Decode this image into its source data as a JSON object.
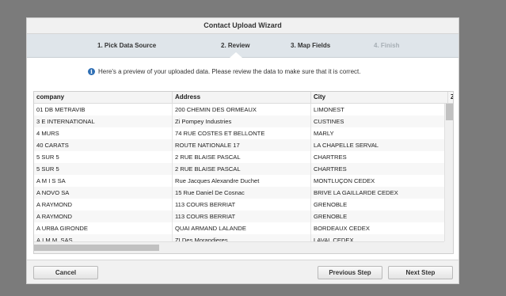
{
  "wizard": {
    "title": "Contact Upload Wizard",
    "steps": [
      {
        "label": "1. Pick Data Source",
        "state": "complete"
      },
      {
        "label": "2. Review",
        "state": "active"
      },
      {
        "label": "3. Map Fields",
        "state": "pending"
      },
      {
        "label": "4. Finish",
        "state": "disabled"
      }
    ],
    "info_icon": "info-circle-icon",
    "info_text": "Here's a preview of your uploaded data. Please review the data to make sure that it is correct."
  },
  "grid": {
    "columns": [
      "company",
      "Address",
      "City",
      "Z"
    ],
    "rows": [
      [
        "01 DB METRAVIB",
        "200 CHEMIN DES ORMEAUX",
        "LIMONEST"
      ],
      [
        "3 E INTERNATIONAL",
        "Zi Pompey Industries",
        "CUSTINES"
      ],
      [
        "4 MURS",
        "74 RUE COSTES ET BELLONTE",
        "MARLY"
      ],
      [
        "40 CARATS",
        "ROUTE NATIONALE 17",
        "LA CHAPELLE SERVAL"
      ],
      [
        "5 SUR 5",
        "2 RUE BLAISE PASCAL",
        "CHARTRES"
      ],
      [
        "5 SUR 5",
        "2 RUE BLAISE PASCAL",
        "CHARTRES"
      ],
      [
        "A M I S SA",
        "Rue Jacques Alexandre Duchet",
        "MONTLUÇON CEDEX"
      ],
      [
        "A NOVO SA",
        "15 Rue Daniel De Cosnac",
        "BRIVE LA GAILLARDE CEDEX"
      ],
      [
        "A RAYMOND",
        "113 COURS BERRIAT",
        "GRENOBLE"
      ],
      [
        "A RAYMOND",
        "113 COURS BERRIAT",
        "GRENOBLE"
      ],
      [
        "A URBA GIRONDE",
        "QUAI ARMAND LALANDE",
        "BORDEAUX CEDEX"
      ],
      [
        "A.I.M.M. SAS",
        "ZI Des Morandieres",
        "LAVAL CEDEX"
      ]
    ]
  },
  "footer": {
    "cancel_label": "Cancel",
    "previous_label": "Previous Step",
    "next_label": "Next Step"
  }
}
